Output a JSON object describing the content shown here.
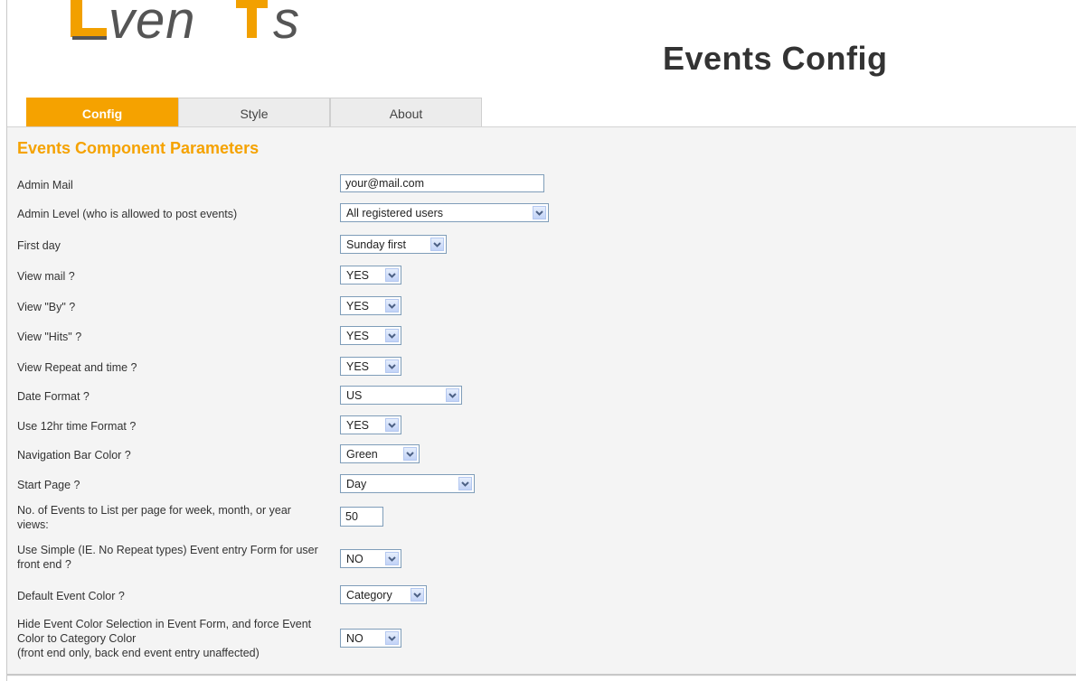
{
  "header": {
    "logo_text": "Events",
    "title": "Events Config"
  },
  "tabs": [
    {
      "label": "Config",
      "active": true
    },
    {
      "label": "Style",
      "active": false
    },
    {
      "label": "About",
      "active": false
    }
  ],
  "colors": {
    "accent": "#f5a200",
    "logo_dark": "#555555",
    "logo_orange": "#f2a000"
  },
  "section": {
    "title": "Events Component Parameters"
  },
  "params": [
    {
      "label": "Admin Mail",
      "type": "text",
      "value": "your@mail.com"
    },
    {
      "label": "Admin Level (who is allowed to post events)",
      "type": "select",
      "value": "All registered users"
    },
    {
      "label": "First day",
      "type": "select",
      "value": "Sunday first"
    },
    {
      "label": "View mail ?",
      "type": "select",
      "value": "YES"
    },
    {
      "label": "View \"By\" ?",
      "type": "select",
      "value": "YES"
    },
    {
      "label": "View \"Hits\" ?",
      "type": "select",
      "value": "YES"
    },
    {
      "label": "View Repeat and time ?",
      "type": "select",
      "value": "YES"
    },
    {
      "label": "Date Format ?",
      "type": "select",
      "value": "US"
    },
    {
      "label": "Use 12hr time Format ?",
      "type": "select",
      "value": "YES"
    },
    {
      "label": "Navigation Bar Color ?",
      "type": "select",
      "value": "Green"
    },
    {
      "label": "Start Page ?",
      "type": "select",
      "value": "Day"
    },
    {
      "label": "No. of Events to List per page for week, month, or year views:",
      "type": "text",
      "value": "50"
    },
    {
      "label": "Use Simple (IE. No Repeat types) Event entry Form for user front end ?",
      "type": "select",
      "value": "NO"
    },
    {
      "label": "Default Event Color ?",
      "type": "select",
      "value": "Category"
    },
    {
      "label": "Hide Event Color Selection in Event Form, and force Event Color to Category Color",
      "label2": "(front end only, back end event entry unaffected)",
      "type": "select",
      "value": "NO"
    }
  ]
}
